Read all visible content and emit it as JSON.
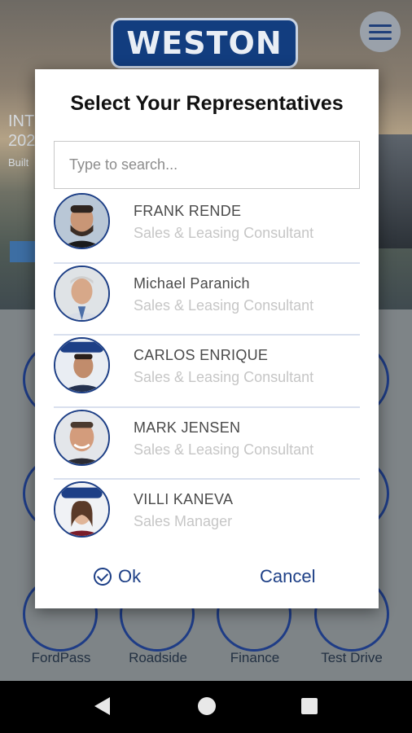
{
  "hero": {
    "brand_logo_text": "WESTON",
    "line1": "INT",
    "line2": "202",
    "line3": "Built"
  },
  "tiles": [
    {
      "label": "FordPass"
    },
    {
      "label": "Roadside"
    },
    {
      "label": "Finance"
    },
    {
      "label": "Test Drive"
    }
  ],
  "dialog": {
    "title": "Select Your Representatives",
    "search_placeholder": "Type to search...",
    "search_value": "",
    "representatives": [
      {
        "name": "FRANK RENDE",
        "role": "Sales & Leasing Consultant"
      },
      {
        "name": "Michael Paranich",
        "role": "Sales & Leasing Consultant"
      },
      {
        "name": "CARLOS ENRIQUE",
        "role": "Sales & Leasing Consultant"
      },
      {
        "name": "MARK JENSEN",
        "role": "Sales & Leasing Consultant"
      },
      {
        "name": "VILLI KANEVA",
        "role": "Sales Manager"
      }
    ],
    "ok_label": "Ok",
    "cancel_label": "Cancel"
  },
  "colors": {
    "accent": "#1d3f86",
    "role_text": "#c6c6c6",
    "name_text": "#4a4a4a"
  },
  "icons": {
    "menu": "hamburger-menu-icon",
    "ok": "check-circle-icon",
    "back": "back-triangle-icon",
    "home": "home-circle-icon",
    "recent": "recent-apps-square-icon"
  }
}
